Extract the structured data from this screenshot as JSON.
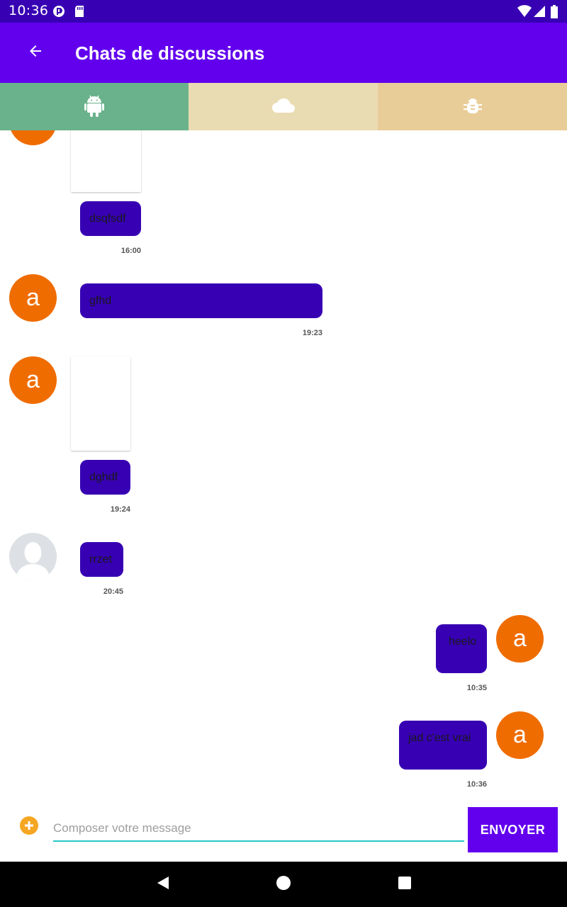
{
  "status_bar": {
    "time": "10:36"
  },
  "app_bar": {
    "title": "Chats de discussions",
    "back_icon": "arrow-left-icon"
  },
  "tabs": [
    {
      "icon": "android-icon",
      "color": "#6ab28b"
    },
    {
      "icon": "cloud-icon",
      "color": "#eadcb2"
    },
    {
      "icon": "bug-icon",
      "color": "#e9cd98"
    }
  ],
  "messages": [
    {
      "text": "dsqfsdf",
      "time": "16:00",
      "avatar": "a"
    },
    {
      "text": "gfhd",
      "time": "19:23",
      "avatar": "a"
    },
    {
      "text": "dghdf",
      "time": "19:24",
      "avatar": "a"
    },
    {
      "text": "rrzet",
      "time": "20:45",
      "avatar": ""
    },
    {
      "text": "heelo",
      "time": "10:35",
      "avatar": "a"
    },
    {
      "text": "jad c'est vrai",
      "time": "10:36",
      "avatar": "a"
    }
  ],
  "composer": {
    "placeholder": "Composer votre message",
    "send_label": "ENVOYER",
    "add_icon": "plus-circle-icon"
  },
  "colors": {
    "status_bar": "#3700b3",
    "app_bar": "#6200ee",
    "bubble": "#3700b3",
    "avatar": "#ef6c00",
    "input_underline": "#26c6c6"
  }
}
